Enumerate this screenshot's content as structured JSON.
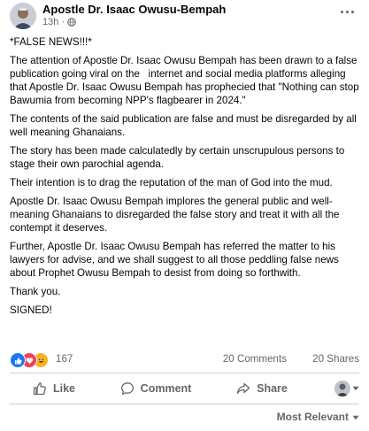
{
  "post": {
    "author": "Apostle Dr. Isaac Owusu-Bempah",
    "time": "13h",
    "audience_icon": "globe-icon",
    "more_icon": "more-options-icon",
    "paragraphs": [
      "*FALSE NEWS!!!*",
      "The attention of Apostle Dr. Isaac Owusu Bempah has been drawn to a false publication going viral on the   internet and social media platforms alleging that Apostle Dr. Isaac Owusu Bempah has prophecied that \"Nothing can stop Bawumia from becoming NPP's flagbearer in 2024.\"",
      "The contents of the said publication are false and must be disregarded by all well meaning Ghanaians.",
      "The story has been made calculatedly by certain unscrupulous persons to stage their own parochial agenda.",
      "Their intention is to drag the reputation of the man of God into the mud.",
      "Apostle Dr. Isaac Owusu Bempah implores the general public and well-meaning Ghanaians to disregarded the false story and treat it with all the contempt it deserves.",
      "Further, Apostle Dr. Isaac Owusu Bempah has referred the matter to his lawyers for advise, and we shall suggest to all those peddling false news about Prophet Owusu Bempah to desist from doing so forthwith.",
      "Thank you.",
      "SIGNED!"
    ]
  },
  "stats": {
    "reaction_icons": [
      "like-reaction-icon",
      "love-reaction-icon",
      "haha-reaction-icon"
    ],
    "reactions": "167",
    "comments": "20 Comments",
    "shares": "20 Shares"
  },
  "actions": {
    "like": "Like",
    "comment": "Comment",
    "share": "Share"
  },
  "sort": {
    "label": "Most Relevant"
  },
  "colors": {
    "like_blue": "#1877f2",
    "love_red": "#f33e58",
    "haha_yellow": "#f7b125",
    "secondary_text": "#65676b"
  }
}
